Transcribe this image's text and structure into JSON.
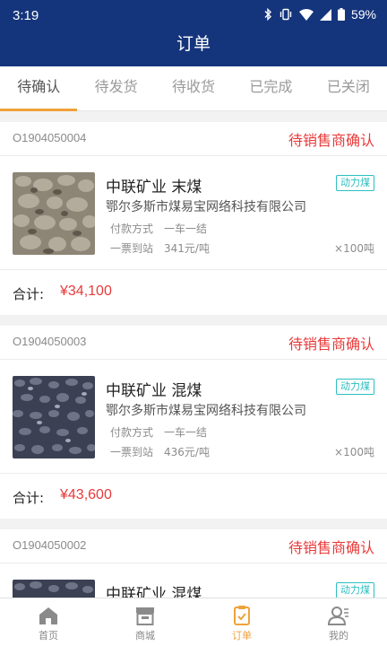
{
  "status_bar": {
    "time": "3:19",
    "battery": "59%"
  },
  "header": {
    "title": "订单"
  },
  "tabs": [
    {
      "label": "待确认",
      "active": true
    },
    {
      "label": "待发货",
      "active": false
    },
    {
      "label": "待收货",
      "active": false
    },
    {
      "label": "已完成",
      "active": false
    },
    {
      "label": "已关闭",
      "active": false
    }
  ],
  "orders": [
    {
      "order_no": "O1904050004",
      "status": "待销售商确认",
      "product": "中联矿业  末煤",
      "tag": "动力煤",
      "company": "鄂尔多斯市煤易宝网络科技有限公司",
      "pay_label": "付款方式",
      "pay_value": "一车一结",
      "trade_label": "一票到站",
      "price": "341元/吨",
      "quantity": "×100吨",
      "total_label": "合计:",
      "total": "¥34,100"
    },
    {
      "order_no": "O1904050003",
      "status": "待销售商确认",
      "product": "中联矿业  混煤",
      "tag": "动力煤",
      "company": "鄂尔多斯市煤易宝网络科技有限公司",
      "pay_label": "付款方式",
      "pay_value": "一车一结",
      "trade_label": "一票到站",
      "price": "436元/吨",
      "quantity": "×100吨",
      "total_label": "合计:",
      "total": "¥43,600"
    },
    {
      "order_no": "O1904050002",
      "status": "待销售商确认",
      "product": "中联矿业  混煤",
      "tag": "动力煤",
      "company": "",
      "pay_label": "",
      "pay_value": "",
      "trade_label": "",
      "price": "",
      "quantity": "",
      "total_label": "",
      "total": ""
    }
  ],
  "bottom_nav": [
    {
      "label": "首页",
      "icon": "home-icon",
      "active": false
    },
    {
      "label": "商城",
      "icon": "store-icon",
      "active": false
    },
    {
      "label": "订单",
      "icon": "order-clipboard-icon",
      "active": true
    },
    {
      "label": "我的",
      "icon": "profile-icon",
      "active": false
    }
  ],
  "colors": {
    "primary": "#14357c",
    "accent": "#f0a13c",
    "status_red": "#e83a3a",
    "tag_teal": "#2cbfc0"
  }
}
